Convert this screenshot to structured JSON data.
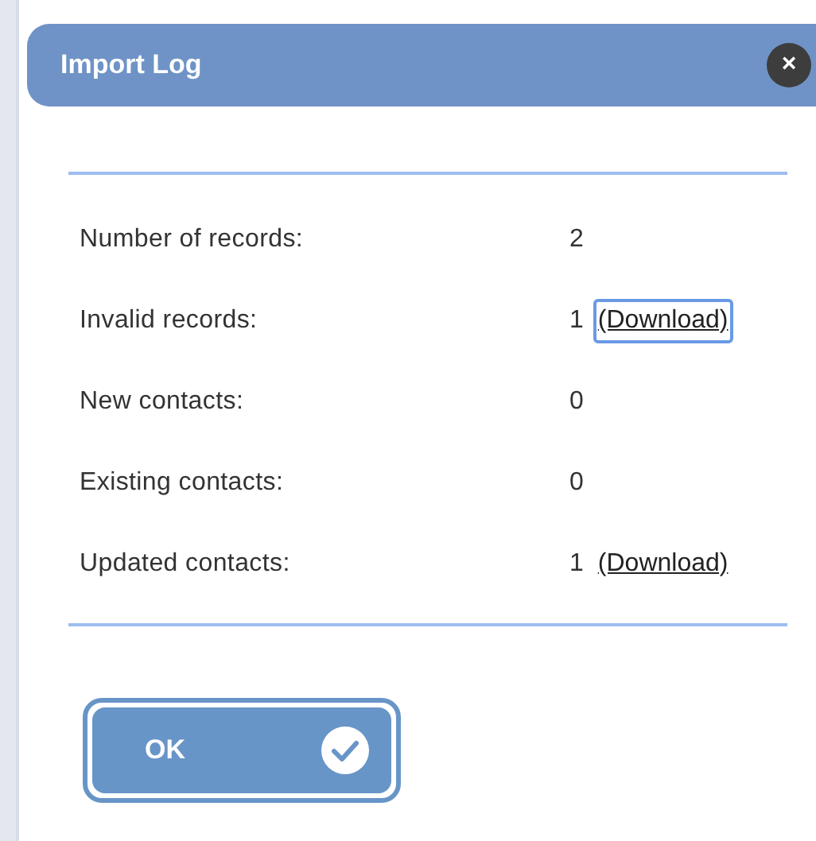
{
  "dialog": {
    "title": "Import Log",
    "close_label": "×"
  },
  "rows": [
    {
      "label": "Number of records:",
      "value": "2"
    },
    {
      "label": "Invalid records:",
      "value": "1",
      "link": {
        "text": "(Download)",
        "focused": true
      }
    },
    {
      "label": "New contacts:",
      "value": "0"
    },
    {
      "label": "Existing contacts:",
      "value": "0"
    },
    {
      "label": "Updated contacts:",
      "value": "1",
      "link": {
        "text": "(Download)",
        "focused": false
      }
    }
  ],
  "ok_button": {
    "label": "OK"
  }
}
